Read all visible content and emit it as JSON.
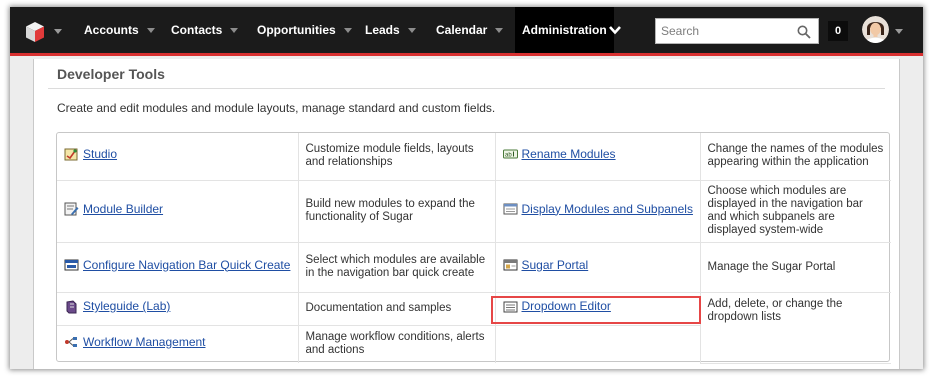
{
  "nav": {
    "tabs": [
      {
        "label": "Accounts"
      },
      {
        "label": "Contacts"
      },
      {
        "label": "Opportunities"
      },
      {
        "label": "Leads"
      },
      {
        "label": "Calendar"
      },
      {
        "label": "Administration"
      }
    ],
    "search_placeholder": "Search",
    "notification_count": "0",
    "accent_color": "#d83030"
  },
  "page": {
    "title": "Developer Tools",
    "description": "Create and edit modules and module layouts, manage standard and custom fields."
  },
  "tools": [
    {
      "name": "Studio",
      "icon": "studio-icon",
      "description": "Customize module fields, layouts and relationships"
    },
    {
      "name": "Rename Modules",
      "icon": "rename-modules-icon",
      "description": "Change the names of the modules appearing within the application"
    },
    {
      "name": "Module Builder",
      "icon": "module-builder-icon",
      "description": "Build new modules to expand the functionality of Sugar"
    },
    {
      "name": "Display Modules and Subpanels",
      "icon": "display-modules-icon",
      "description": "Choose which modules are displayed in the navigation bar and which subpanels are displayed system-wide"
    },
    {
      "name": "Configure Navigation Bar Quick Create",
      "icon": "quick-create-icon",
      "description": "Select which modules are available in the navigation bar quick create"
    },
    {
      "name": "Sugar Portal",
      "icon": "sugar-portal-icon",
      "description": "Manage the Sugar Portal"
    },
    {
      "name": "Styleguide (Lab)",
      "icon": "styleguide-icon",
      "description": "Documentation and samples"
    },
    {
      "name": "Dropdown Editor",
      "icon": "dropdown-editor-icon",
      "description": "Add, delete, or change the dropdown lists"
    },
    {
      "name": "Workflow Management",
      "icon": "workflow-icon",
      "description": "Manage workflow conditions, alerts and actions"
    }
  ]
}
